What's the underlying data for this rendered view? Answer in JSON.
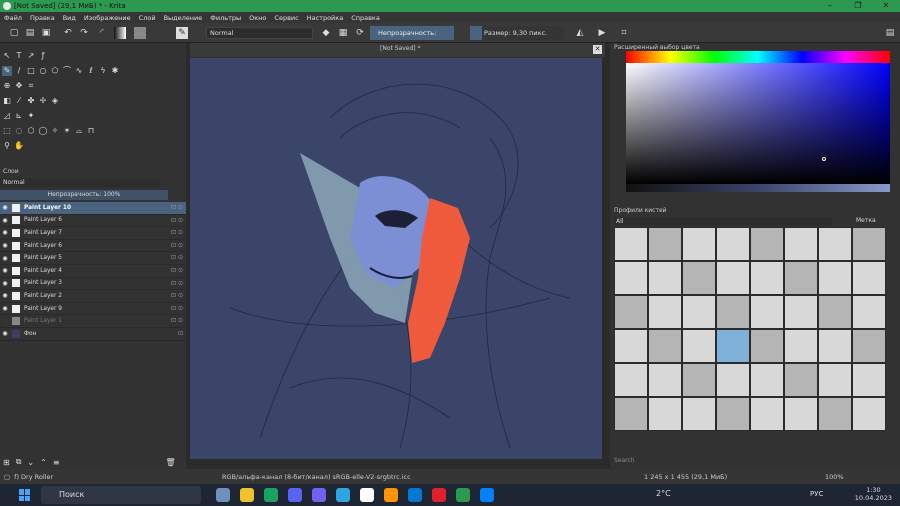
{
  "window": {
    "title": "[Not Saved]  (29,1 МиБ)  * - Krita",
    "buttons": [
      "–",
      "❐",
      "✕"
    ]
  },
  "menu": [
    "Файл",
    "Правка",
    "Вид",
    "Изображение",
    "Слой",
    "Выделение",
    "Фильтры",
    "Окно",
    "Сервис",
    "Настройка",
    "Справка"
  ],
  "toolbar": {
    "blend_mode": "Normal",
    "opacity": "Непрозрачность: 100%",
    "size": "Размер: 9,30 пикс."
  },
  "layers_panel": {
    "title": "Слои",
    "blend_mode": "Normal",
    "opacity": "Непрозрачность:  100%",
    "layers": [
      {
        "name": "Paint Layer 10",
        "selected": true
      },
      {
        "name": "Paint Layer 6"
      },
      {
        "name": "Paint Layer 7"
      },
      {
        "name": "Paint Layer 6"
      },
      {
        "name": "Paint Layer 5"
      },
      {
        "name": "Paint Layer 4"
      },
      {
        "name": "Paint Layer 3"
      },
      {
        "name": "Paint Layer 2"
      },
      {
        "name": "Paint Layer 9"
      },
      {
        "name": "Paint Layer 1",
        "hidden": true
      },
      {
        "name": "Фон",
        "dark": true
      }
    ]
  },
  "document": {
    "tab": "[Not Saved]  *"
  },
  "color_selector": {
    "title": "Расширенный выбор цвета"
  },
  "brushes": {
    "title": "Профили кистей",
    "filter": "All",
    "tag": "Метка",
    "search": "Search",
    "selected_index": 27
  },
  "status": {
    "brush": "f) Dry Roller",
    "color_space": "RGB/альфа-канал (8-бит/канал)  sRGB-elle-V2-srgbtrc.icc",
    "dimensions": "1 245 x 1 455 (29,1 МиБ)",
    "zoom": "100%"
  },
  "taskbar": {
    "search": "Поиск",
    "weather": "2°C",
    "lang": "РУС",
    "time": "1:30",
    "date": "10.04.2023"
  }
}
